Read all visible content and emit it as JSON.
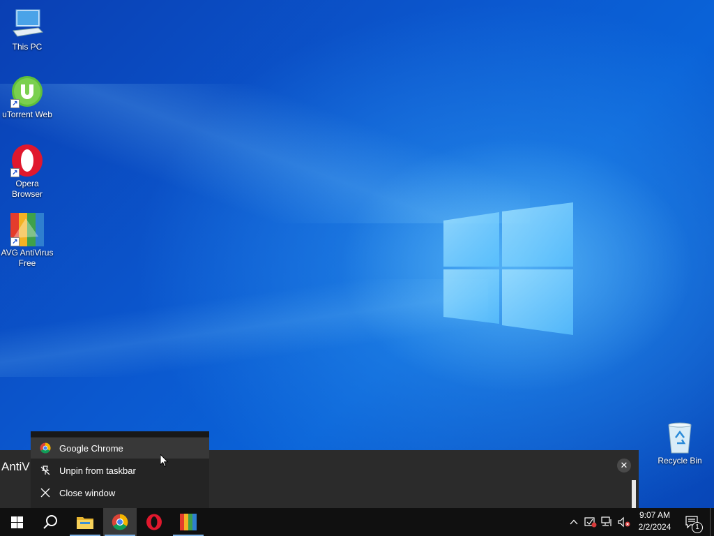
{
  "desktop": {
    "icons": [
      {
        "label": "This PC",
        "icon": "computer-icon"
      },
      {
        "label": "uTorrent Web",
        "icon": "utorrent-icon"
      },
      {
        "label": "Opera Browser",
        "icon": "opera-icon"
      },
      {
        "label": "AVG AntiVirus Free",
        "icon": "avg-icon"
      },
      {
        "label": "Recycle Bin",
        "icon": "recycle-bin-icon"
      }
    ]
  },
  "preview": {
    "title": "AntiV",
    "close_glyph": "✕"
  },
  "jumplist": {
    "items": [
      {
        "label": "Google Chrome",
        "icon": "chrome-icon"
      },
      {
        "label": "Unpin from taskbar",
        "icon": "unpin-icon"
      },
      {
        "label": "Close window",
        "icon": "close-icon"
      }
    ]
  },
  "taskbar": {
    "apps": [
      "start-icon",
      "search-icon",
      "file-explorer-icon",
      "chrome-icon",
      "opera-icon",
      "avg-icon"
    ],
    "active_app": "chrome-icon"
  },
  "clock": {
    "time": "9:07 AM",
    "date": "2/2/2024"
  },
  "notifications": {
    "count": "1"
  },
  "colors": {
    "taskbar": "#101010",
    "accent": "#7fb3e6",
    "menu_bg": "#242424"
  }
}
